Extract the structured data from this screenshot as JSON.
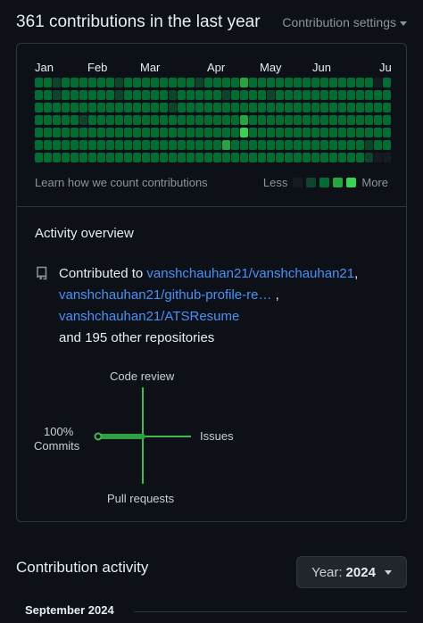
{
  "header": {
    "title": "361 contributions in the last year",
    "settings_label": "Contribution settings"
  },
  "graph": {
    "months": [
      "Jan",
      "Feb",
      "Mar",
      "Apr",
      "May",
      "Jun",
      "Ju"
    ],
    "learn_link": "Learn how we count contributions",
    "legend_less": "Less",
    "legend_more": "More",
    "levels": [
      "#161b22",
      "#0e4429",
      "#006d32",
      "#26a641",
      "#39d353"
    ],
    "rows": [
      [
        2,
        2,
        1,
        2,
        2,
        2,
        2,
        2,
        2,
        1,
        2,
        2,
        2,
        2,
        2,
        2,
        2,
        2,
        1,
        2,
        2,
        2,
        2,
        3,
        2,
        2,
        2,
        2,
        2,
        2,
        2,
        2,
        2,
        2,
        2,
        2,
        2,
        2,
        0,
        2
      ],
      [
        2,
        2,
        1,
        2,
        2,
        2,
        2,
        2,
        2,
        1,
        2,
        2,
        2,
        2,
        2,
        1,
        2,
        2,
        2,
        2,
        2,
        1,
        2,
        2,
        2,
        2,
        1,
        2,
        2,
        2,
        2,
        2,
        2,
        2,
        2,
        2,
        2,
        2,
        2,
        2
      ],
      [
        2,
        2,
        2,
        2,
        2,
        2,
        2,
        2,
        2,
        2,
        2,
        2,
        2,
        2,
        2,
        1,
        2,
        2,
        2,
        2,
        2,
        2,
        2,
        2,
        2,
        2,
        2,
        2,
        2,
        2,
        2,
        2,
        2,
        2,
        2,
        2,
        2,
        2,
        2,
        2
      ],
      [
        2,
        2,
        2,
        2,
        2,
        1,
        2,
        2,
        2,
        2,
        2,
        2,
        2,
        2,
        2,
        2,
        2,
        2,
        2,
        2,
        2,
        2,
        2,
        3,
        2,
        2,
        2,
        2,
        2,
        2,
        2,
        2,
        2,
        2,
        2,
        2,
        2,
        2,
        2,
        2
      ],
      [
        2,
        2,
        2,
        2,
        2,
        2,
        2,
        2,
        2,
        2,
        2,
        2,
        2,
        2,
        2,
        2,
        2,
        2,
        2,
        2,
        2,
        2,
        2,
        4,
        2,
        2,
        2,
        2,
        2,
        2,
        2,
        2,
        2,
        2,
        2,
        2,
        2,
        2,
        2,
        2
      ],
      [
        2,
        2,
        2,
        2,
        2,
        2,
        2,
        2,
        2,
        2,
        2,
        2,
        2,
        2,
        2,
        2,
        2,
        2,
        2,
        2,
        2,
        3,
        2,
        2,
        2,
        2,
        2,
        2,
        2,
        2,
        2,
        2,
        2,
        2,
        2,
        2,
        2,
        1,
        2,
        2
      ],
      [
        2,
        2,
        2,
        2,
        2,
        2,
        2,
        2,
        2,
        2,
        2,
        2,
        2,
        2,
        2,
        2,
        2,
        2,
        2,
        2,
        2,
        2,
        2,
        2,
        2,
        2,
        2,
        2,
        2,
        2,
        2,
        2,
        2,
        2,
        2,
        2,
        2,
        1,
        0,
        0
      ]
    ]
  },
  "overview": {
    "title": "Activity overview",
    "contributed_to": "Contributed to",
    "repo1": "vanshchauhan21/vanshchauhan21",
    "repo2": "vanshchauhan21/github-profile-re…",
    "repo3": "vanshchauhan21/ATSResume",
    "others": "and 195 other repositories",
    "comma": ","
  },
  "activity_axes": {
    "code_review": "Code review",
    "issues": "Issues",
    "pull_requests": "Pull requests",
    "commits_percent": "100%",
    "commits": "Commits"
  },
  "contribution_activity": {
    "title": "Contribution activity",
    "year_label": "Year:",
    "year_value": "2024",
    "month_heading": "September 2024"
  }
}
